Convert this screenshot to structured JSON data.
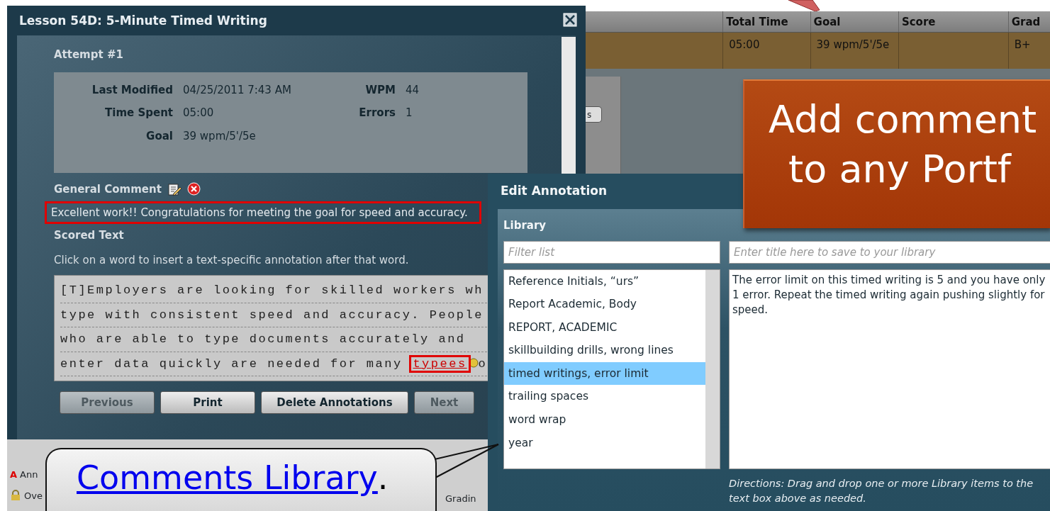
{
  "background_grid": {
    "columns": [
      "Total Time",
      "Goal",
      "Score",
      "Grad"
    ],
    "row": {
      "total_time": "05:00",
      "goal": "39 wpm/5'/5e",
      "grade": "B+"
    },
    "button_fragment": "s",
    "legend": [
      {
        "kind": "annotation",
        "marker": "A",
        "label": "Ann"
      },
      {
        "kind": "lock",
        "label": "Ove"
      }
    ],
    "grading_fragment": "Gradin"
  },
  "lesson_dialog": {
    "title": "Lesson 54D: 5-Minute Timed Writing",
    "attempt": "Attempt #1",
    "stats": [
      {
        "label": "Last Modified",
        "value": "04/25/2011 7:43 AM"
      },
      {
        "label": "WPM",
        "value": "44"
      },
      {
        "label": "Time Spent",
        "value": "05:00"
      },
      {
        "label": "Errors",
        "value": "1"
      },
      {
        "label": "Goal",
        "value": "39 wpm/5'/5e"
      }
    ],
    "general_comment": {
      "label": "General Comment",
      "text": "Excellent work!! Congratulations for meeting the goal for speed and accuracy.",
      "highlighted": true
    },
    "scored_text": {
      "heading": "Scored Text",
      "instruction": "Click on a word to insert a text-specific annotation after that word.",
      "lines": [
        "[T]Employers are looking for skilled workers wh",
        "type with consistent speed and accuracy. People",
        "who are able to type documents accurately and",
        "enter data quickly are needed for many "
      ],
      "annotated_word": "typees",
      "after_word": "o",
      "highlighted": true
    },
    "buttons": [
      {
        "label": "Previous",
        "disabled": true
      },
      {
        "label": "Print",
        "disabled": false
      },
      {
        "label": "Delete Annotations",
        "disabled": false
      },
      {
        "label": "Next",
        "disabled": true
      }
    ]
  },
  "edit_annotation": {
    "title": "Edit Annotation",
    "library_label": "Library",
    "filter": {
      "placeholder": "Filter list"
    },
    "title_field": {
      "placeholder": "Enter title here to save to your library"
    },
    "items": [
      {
        "label": "Reference Initials, “urs”",
        "selected": false
      },
      {
        "label": "Report Academic, Body",
        "selected": false
      },
      {
        "label": "REPORT, ACADEMIC",
        "selected": false
      },
      {
        "label": "skillbuilding drills, wrong lines",
        "selected": false
      },
      {
        "label": "timed writings, error limit",
        "selected": true
      },
      {
        "label": "trailing spaces",
        "selected": false
      },
      {
        "label": "word wrap",
        "selected": false
      },
      {
        "label": "year",
        "selected": false
      }
    ],
    "annotation_text": "The error limit on this timed writing is 5 and you have only 1 error. Repeat the timed writing again pushing slightly for speed.",
    "directions": "Directions: Drag and drop one or more Library items to the text box above as needed."
  },
  "orange_callout": {
    "lines": [
      "Add comment",
      "to any Portf"
    ]
  },
  "speech_bubble": {
    "link": "Comments Library",
    "trailing": "."
  }
}
